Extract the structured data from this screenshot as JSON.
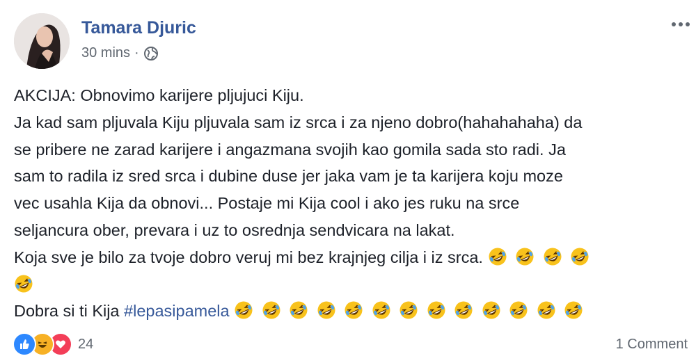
{
  "post": {
    "author": "Tamara Djuric",
    "time": "30 mins",
    "separator": "·",
    "audience_icon": "globe-icon",
    "lines": [
      "AKCIJA: Obnovimo karijere pljujuci Kiju.",
      "Ja kad sam pljuvala Kiju pljuvala sam iz srca i za njeno dobro(hahahahaha) da",
      "se pribere ne zarad karijere i angazmana svojih kao gomila sada sto radi. Ja",
      "sam to radila iz sred srca i dubine duse jer jaka vam je ta karijera koju moze",
      "vec usahla Kija da obnovi... Postaje mi Kija cool i ako jes ruku na srce",
      "seljancura ober, prevara i uz to osrednja sendvicara na lakat.",
      "Koja sve je bilo za tvoje dobro veruj mi bez krajnjeg cilja i iz srca."
    ],
    "last_line_text": "Dobra si ti Kija",
    "hashtag": "#lepasipamela",
    "emoji_name": "rolling-on-floor-laughing",
    "emoji_after_line7": 4,
    "emoji_on_line8": 1,
    "emoji_last_line": 13
  },
  "footer": {
    "reaction_icons": [
      "like-icon",
      "haha-icon",
      "love-icon"
    ],
    "reaction_count": "24",
    "comments": "1 Comment"
  },
  "colors": {
    "link": "#365899",
    "secondary": "#606770",
    "like": "#2d88ff",
    "haha": "#f7b125",
    "love": "#f33e58"
  }
}
